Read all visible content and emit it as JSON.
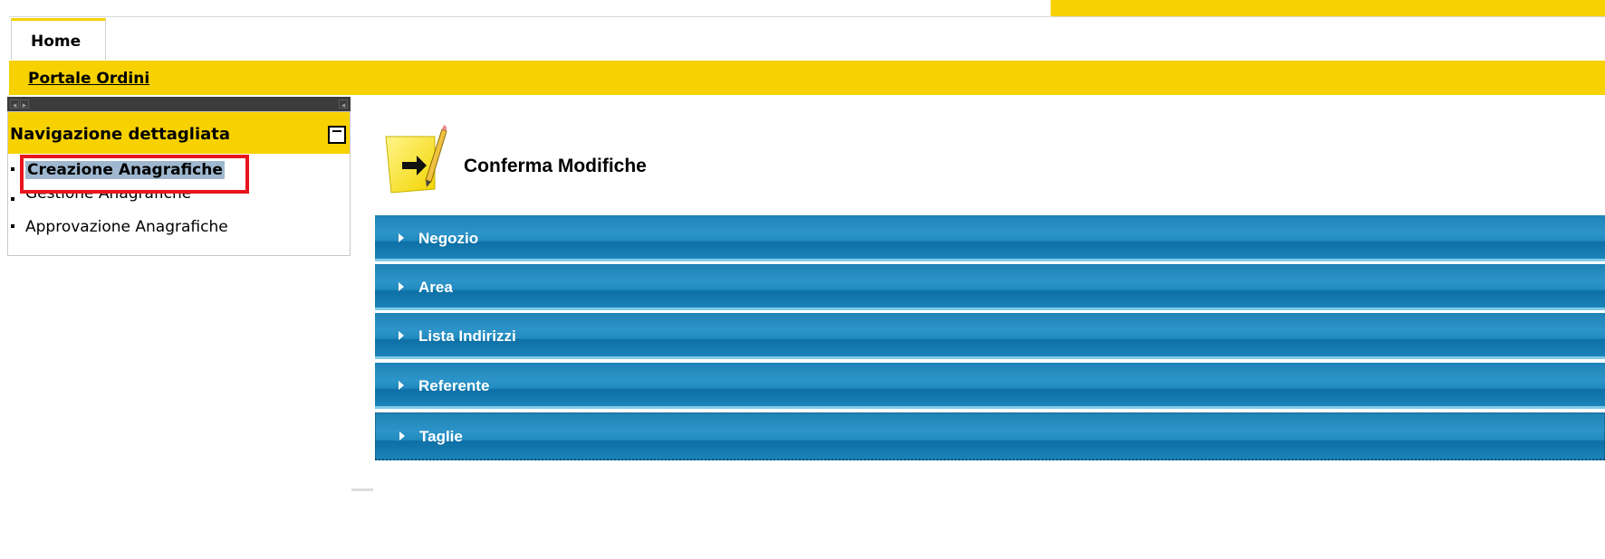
{
  "tabs": {
    "home_label": "Home"
  },
  "breadcrumb": {
    "portal_label": "Portale Ordini"
  },
  "sidebar": {
    "title": "Navigazione dettagliata",
    "items": [
      {
        "label": "Creazione Anagrafiche",
        "selected": true
      },
      {
        "label": "Gestione Anagrafiche",
        "selected": false
      },
      {
        "label": "Approvazione Anagrafiche",
        "selected": false
      }
    ]
  },
  "main": {
    "heading": "Conferma Modifiche",
    "sections": [
      {
        "label": "Negozio"
      },
      {
        "label": "Area"
      },
      {
        "label": "Lista Indirizzi"
      },
      {
        "label": "Referente"
      },
      {
        "label": "Taglie"
      }
    ]
  },
  "colors": {
    "accent_yellow": "#f7d100",
    "section_blue": "#2c94c8",
    "selection_highlight": "#9fb8cf",
    "annotation_red": "#e8161c"
  },
  "icons": {
    "heading_icon": "arrow-note-pencil-icon",
    "section_toggle": "caret-right-icon",
    "panel_toggle": "collapse-icon"
  }
}
